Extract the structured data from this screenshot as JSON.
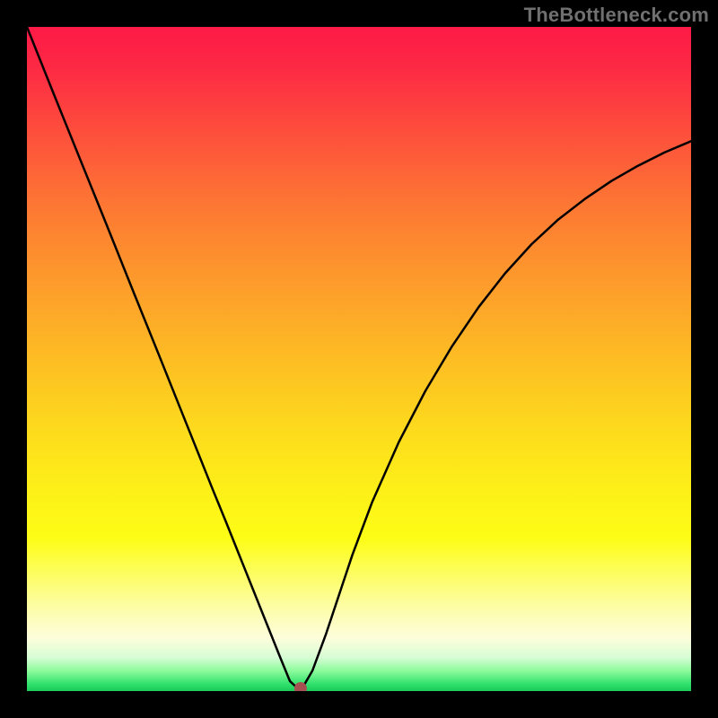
{
  "watermark": "TheBottleneck.com",
  "chart_data": {
    "type": "line",
    "title": "",
    "xlabel": "",
    "ylabel": "",
    "xlim": [
      0,
      1
    ],
    "ylim": [
      0,
      1
    ],
    "series": [
      {
        "name": "bottleneck-curve",
        "x": [
          0.0,
          0.04,
          0.08,
          0.12,
          0.16,
          0.2,
          0.24,
          0.28,
          0.3,
          0.32,
          0.34,
          0.36,
          0.38,
          0.396,
          0.412,
          0.43,
          0.45,
          0.47,
          0.49,
          0.52,
          0.56,
          0.6,
          0.64,
          0.68,
          0.72,
          0.76,
          0.8,
          0.84,
          0.88,
          0.92,
          0.96,
          1.0
        ],
        "y": [
          1.0,
          0.9,
          0.801,
          0.702,
          0.602,
          0.503,
          0.403,
          0.303,
          0.254,
          0.204,
          0.154,
          0.104,
          0.054,
          0.015,
          0.0,
          0.031,
          0.085,
          0.145,
          0.205,
          0.285,
          0.375,
          0.452,
          0.519,
          0.578,
          0.629,
          0.673,
          0.71,
          0.741,
          0.768,
          0.791,
          0.811,
          0.828
        ]
      }
    ],
    "marker": {
      "x": 0.412,
      "y": 0.0
    },
    "gradient_stops": [
      {
        "pos": 0.0,
        "color": "#fd1a47"
      },
      {
        "pos": 0.5,
        "color": "#fdc020"
      },
      {
        "pos": 0.77,
        "color": "#fdfd16"
      },
      {
        "pos": 0.95,
        "color": "#d5fdd5"
      },
      {
        "pos": 1.0,
        "color": "#1acc58"
      }
    ]
  }
}
